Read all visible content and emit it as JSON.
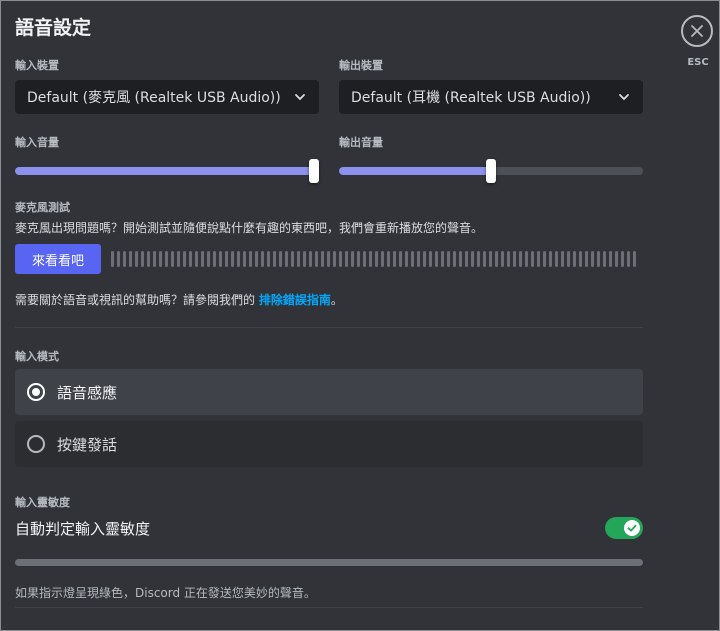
{
  "title": "語音設定",
  "close": {
    "label": "ESC",
    "icon": "close-icon"
  },
  "input_device": {
    "label": "輸入裝置",
    "value": "Default (麥克風 (Realtek USB Audio))"
  },
  "output_device": {
    "label": "輸出裝置",
    "value": "Default (耳機 (Realtek USB Audio))"
  },
  "input_volume": {
    "label": "輸入音量",
    "level_fraction": 1.0
  },
  "output_volume": {
    "label": "輸出音量",
    "level_fraction": 0.5
  },
  "mic_test": {
    "label": "麥克風測試",
    "description": "麥克風出現問題嗎？開始測試並隨便說點什麼有趣的東西吧，我們會重新播放您的聲音。",
    "button_label": "來看看吧"
  },
  "help": {
    "text": "需要關於語音或視訊的幫助嗎？請參閱我們的 ",
    "link_label": "排除錯誤指南",
    "suffix": "。"
  },
  "input_mode": {
    "label": "輸入模式",
    "options": [
      {
        "label": "語音感應",
        "selected": true
      },
      {
        "label": "按鍵發話",
        "selected": false
      }
    ]
  },
  "sensitivity": {
    "label": "輸入靈敏度",
    "auto_label": "自動判定輸入靈敏度",
    "auto_enabled": true,
    "note": "如果指示燈呈現綠色，Discord 正在發送您美妙的聲音。"
  },
  "colors": {
    "accent": "#5865f2",
    "slider": "#8c91ee",
    "toggle_on": "#23a55a",
    "link": "#00a8fc",
    "background": "#313338"
  }
}
